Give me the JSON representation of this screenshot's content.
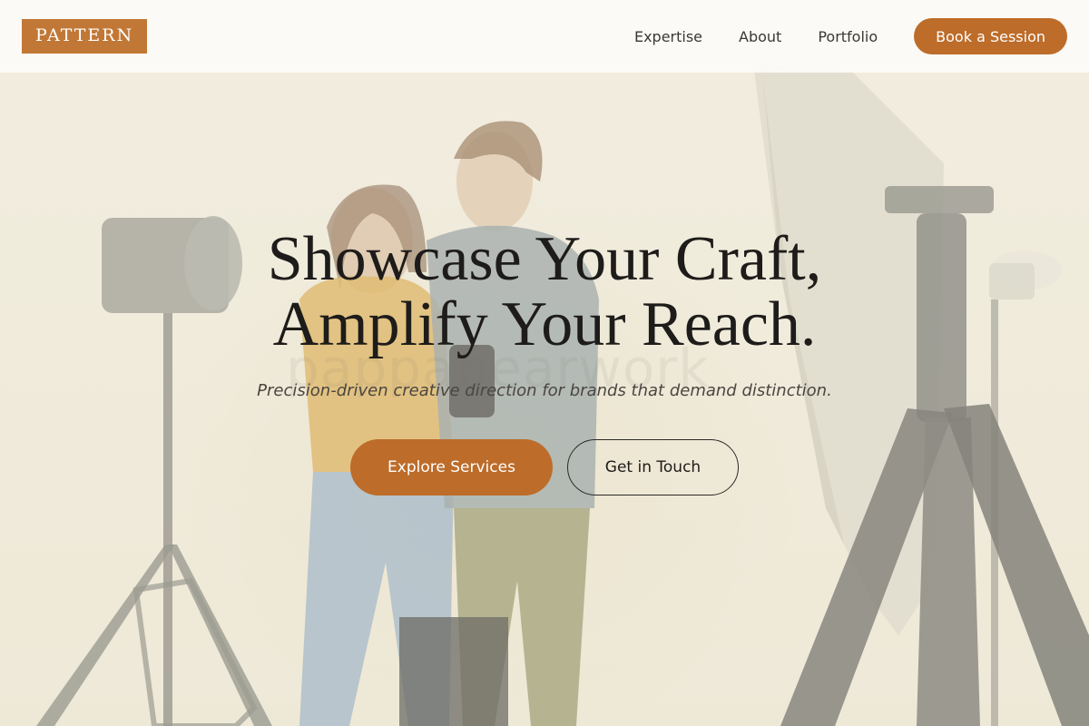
{
  "brand": {
    "logo_text": "PATTERN",
    "accent_color": "#bd6c29",
    "logo_color": "#c17836"
  },
  "nav": {
    "links": [
      {
        "label": "Expertise"
      },
      {
        "label": "About"
      },
      {
        "label": "Portfolio"
      }
    ],
    "cta_label": "Book a Session"
  },
  "hero": {
    "title_line1": "Showcase Your Craft,",
    "title_line2": "Amplify Your Reach.",
    "subtitle": "Precision-driven creative direction for brands that demand distinction.",
    "primary_button": "Explore Services",
    "secondary_button": "Get in Touch",
    "background_image": "photo-studio-couple-with-lighting-equipment"
  }
}
